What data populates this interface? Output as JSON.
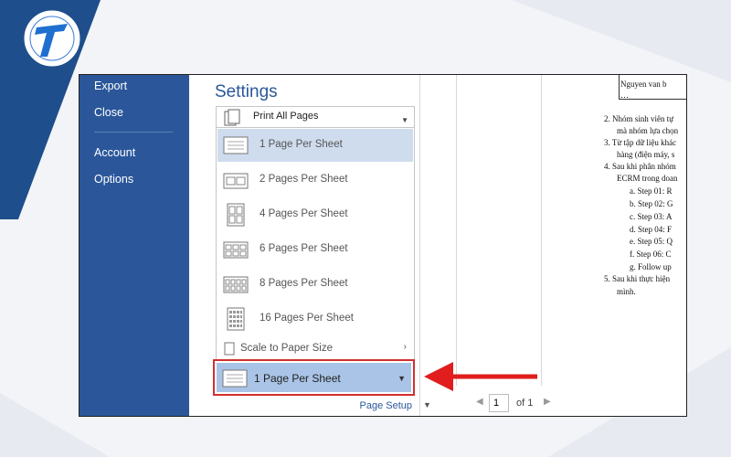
{
  "sidebar": {
    "items": [
      {
        "label": "Export"
      },
      {
        "label": "Close"
      },
      {
        "label": "Account"
      },
      {
        "label": "Options"
      }
    ],
    "background": "#2b579a"
  },
  "settings": {
    "title": "Settings",
    "print_what": {
      "label": "Print All Pages",
      "icon": "print-pages-icon"
    },
    "pages_per_sheet_options": [
      {
        "label": "1 Page Per Sheet",
        "selected": true
      },
      {
        "label": "2 Pages Per Sheet",
        "selected": false
      },
      {
        "label": "4 Pages Per Sheet",
        "selected": false
      },
      {
        "label": "6 Pages Per Sheet",
        "selected": false
      },
      {
        "label": "8 Pages Per Sheet",
        "selected": false
      },
      {
        "label": "16 Pages Per Sheet",
        "selected": false
      }
    ],
    "scale_to_paper": {
      "label": "Scale to Paper Size",
      "icon": "scale-paper-icon"
    },
    "current_selection": {
      "label": "1 Page Per Sheet"
    },
    "page_setup_link": "Page Setup"
  },
  "preview": {
    "page_input": "1",
    "page_of": "of 1",
    "document_lines": [
      {
        "text": "Nguyen van b"
      },
      {
        "text": "…"
      },
      {
        "text": "2.  Nhóm sinh viên tự"
      },
      {
        "text": "mà nhóm lựa chọn"
      },
      {
        "text": "3.  Từ tập dữ liệu khác"
      },
      {
        "text": "hàng (điện máy, s"
      },
      {
        "text": "4.  Sau khi phân nhóm"
      },
      {
        "text": "ECRM trong doan"
      },
      {
        "text": "a.   Step 01: R"
      },
      {
        "text": "b.   Step 02: G"
      },
      {
        "text": "c.   Step 03: A"
      },
      {
        "text": "d.   Step 04: F"
      },
      {
        "text": "e.   Step 05:  Q"
      },
      {
        "text": "f.    Step 06: C"
      },
      {
        "text": "g.   Follow up"
      },
      {
        "text": "5.  Sau khi thực hiện"
      },
      {
        "text": "mình."
      }
    ]
  },
  "colors": {
    "accent": "#2b579a",
    "highlight": "#d32f2f",
    "selected_fill": "#a9c4e6"
  }
}
